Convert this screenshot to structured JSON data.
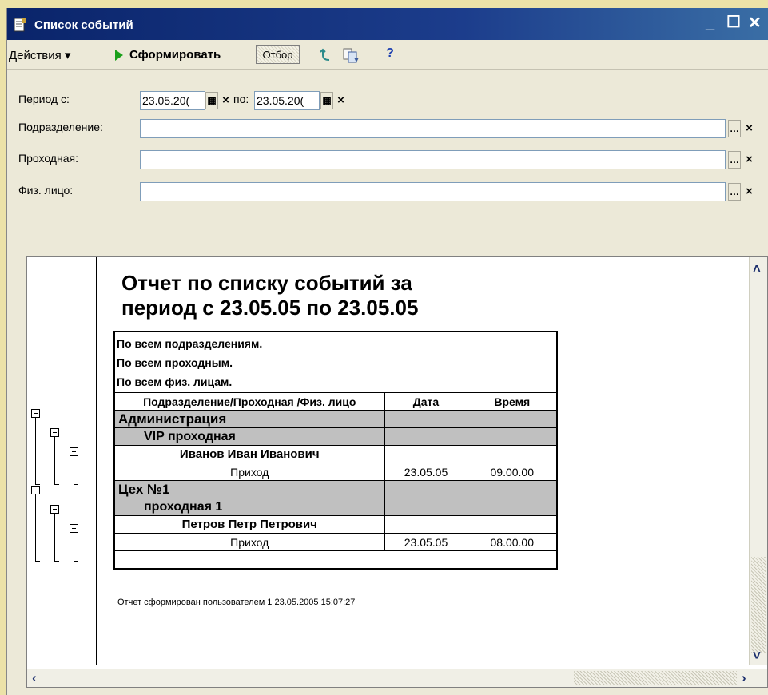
{
  "window": {
    "title": "Список событий",
    "minimize": "_",
    "maximize": "☐",
    "close": "✕"
  },
  "toolbar": {
    "actions": "Действия ▾",
    "generate": "Сформировать",
    "filter": "Отбор",
    "help": "?"
  },
  "form": {
    "period_from_label": "Период с:",
    "period_from_value": "23.05.20(",
    "period_to_label": "по:",
    "period_to_value": "23.05.20(",
    "department_label": "Подразделение:",
    "department_value": "",
    "checkpoint_label": "Проходная:",
    "checkpoint_value": "",
    "person_label": "Физ. лицо:",
    "person_value": ""
  },
  "report": {
    "title_line1": "Отчет по списку событий за",
    "title_line2": "период с 23.05.05 по 23.05.05",
    "info": [
      "По всем подразделениям.",
      "По всем проходным.",
      "По всем физ. лицам."
    ],
    "columns": [
      "Подразделение/Проходная /Физ. лицо",
      "Дата",
      "Время"
    ],
    "rows": [
      {
        "level": 1,
        "name": "Администрация",
        "date": "",
        "time": ""
      },
      {
        "level": 2,
        "name": "VIP проходная",
        "date": "",
        "time": ""
      },
      {
        "level": 3,
        "name": "Иванов Иван Иванович",
        "date": "",
        "time": ""
      },
      {
        "level": 4,
        "name": "Приход",
        "date": "23.05.05",
        "time": "09.00.00"
      },
      {
        "level": 1,
        "name": "Цех №1",
        "date": "",
        "time": ""
      },
      {
        "level": 2,
        "name": "проходная 1",
        "date": "",
        "time": ""
      },
      {
        "level": 3,
        "name": "Петров Петр Петрович",
        "date": "",
        "time": ""
      },
      {
        "level": 4,
        "name": "Приход",
        "date": "23.05.05",
        "time": "08.00.00"
      }
    ],
    "footer": "Отчет сформирован пользователем 1 23.05.2005 15:07:27"
  },
  "colors": {
    "titlebar": "#0a246a",
    "window_bg": "#ece9d8",
    "group_row": "#c0c0c0",
    "desktop": "#ece2a8"
  }
}
